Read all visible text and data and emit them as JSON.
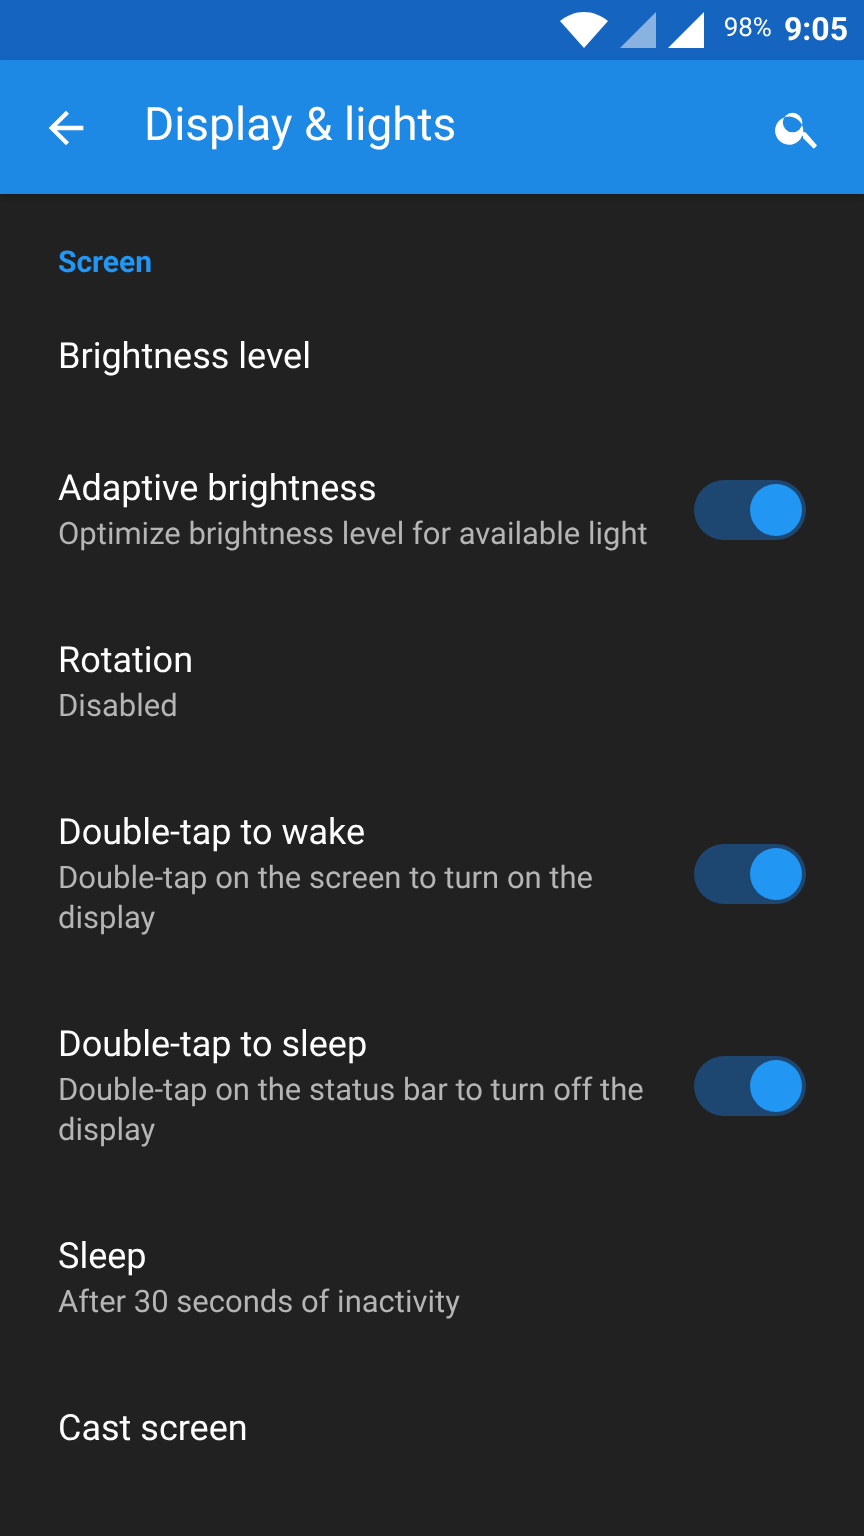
{
  "status_bar": {
    "battery": "98%",
    "time": "9:05"
  },
  "app_bar": {
    "title": "Display & lights"
  },
  "section": {
    "title": "Screen"
  },
  "items": [
    {
      "kind": "plain",
      "title": "Brightness level"
    },
    {
      "kind": "toggle",
      "title": "Adaptive brightness",
      "subtitle": "Optimize brightness level for available light",
      "on": true
    },
    {
      "kind": "plain",
      "title": "Rotation",
      "subtitle": "Disabled"
    },
    {
      "kind": "toggle",
      "title": "Double-tap to wake",
      "subtitle": "Double-tap on the screen to turn on the display",
      "on": true
    },
    {
      "kind": "toggle",
      "title": "Double-tap to sleep",
      "subtitle": "Double-tap on the status bar to turn off the display",
      "on": true
    },
    {
      "kind": "plain",
      "title": "Sleep",
      "subtitle": "After 30 seconds of inactivity"
    },
    {
      "kind": "plain",
      "title": "Cast screen"
    }
  ]
}
